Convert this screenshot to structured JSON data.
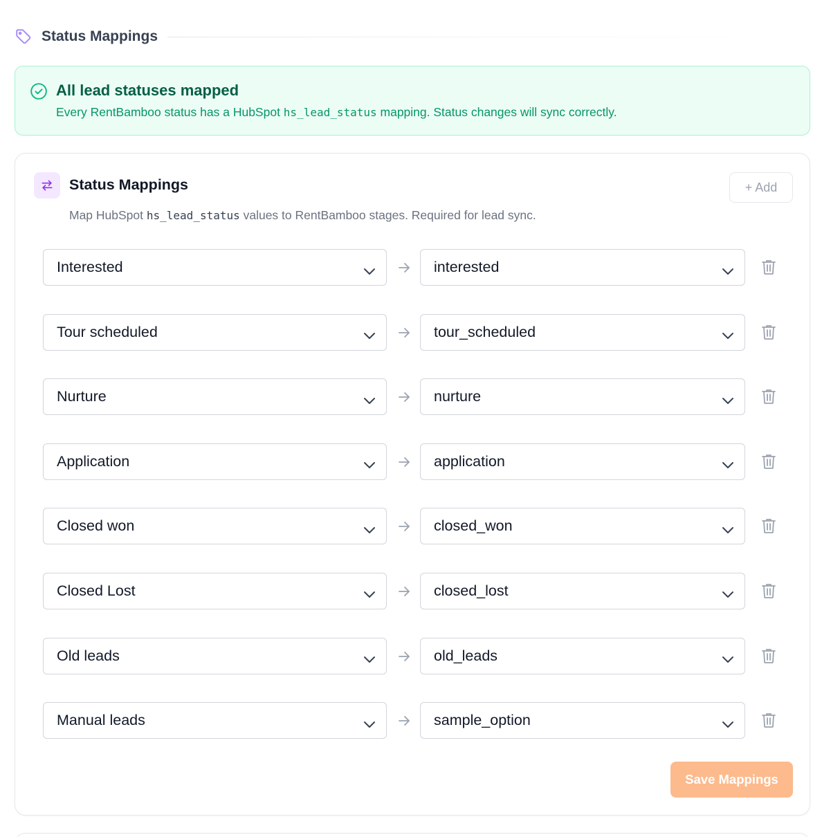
{
  "section": {
    "title": "Status Mappings",
    "icon": "tag-icon"
  },
  "banner": {
    "title": "All lead statuses mapped",
    "text_before": "Every RentBamboo status has a HubSpot ",
    "text_code": "hs_lead_status",
    "text_after": " mapping. Status changes will sync correctly.",
    "icon": "check-circle-icon"
  },
  "card": {
    "title": "Status Mappings",
    "desc_before": "Map HubSpot ",
    "desc_code": "hs_lead_status",
    "desc_after": " values to RentBamboo stages. Required for lead sync.",
    "add_label": "+ Add",
    "save_label": "Save Mappings",
    "icon": "swap-arrows-icon"
  },
  "mappings": [
    {
      "hubspot": "Interested",
      "stage": "interested"
    },
    {
      "hubspot": "Tour scheduled",
      "stage": "tour_scheduled"
    },
    {
      "hubspot": "Nurture",
      "stage": "nurture"
    },
    {
      "hubspot": "Application",
      "stage": "application"
    },
    {
      "hubspot": "Closed won",
      "stage": "closed_won"
    },
    {
      "hubspot": "Closed Lost",
      "stage": "closed_lost"
    },
    {
      "hubspot": "Old leads",
      "stage": "old_leads"
    },
    {
      "hubspot": "Manual leads",
      "stage": "sample_option"
    }
  ],
  "colors": {
    "accent_purple": "#a78bfa",
    "success_bg": "#ecfdf5",
    "success_text": "#059669",
    "save_disabled": "#fdba8c"
  }
}
